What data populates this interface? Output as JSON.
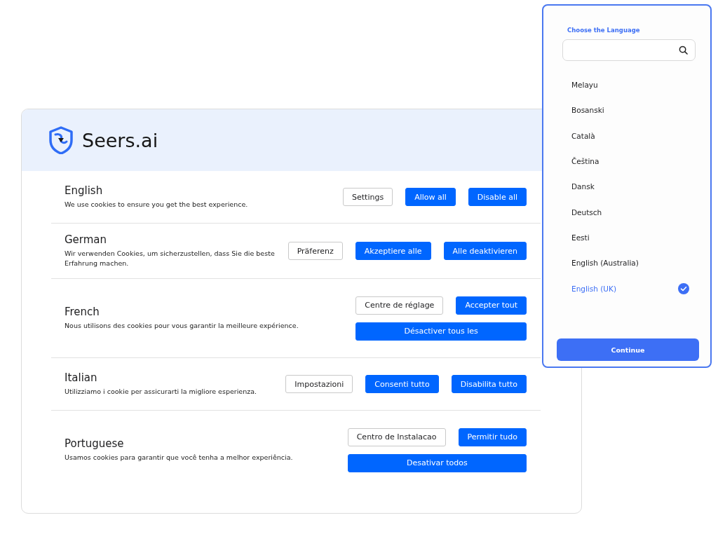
{
  "brand": {
    "name": "Seers.ai"
  },
  "languages": [
    {
      "title": "English",
      "text": "We use cookies to ensure you get the best experience.",
      "buttons": [
        {
          "label": "Settings",
          "kind": "outline"
        },
        {
          "label": "Allow all",
          "kind": "primary"
        },
        {
          "label": "Disable all",
          "kind": "primary"
        }
      ]
    },
    {
      "title": "German",
      "text": "Wir verwenden Cookies, um sicherzustellen, dass Sie die beste Erfahrung machen.",
      "buttons": [
        {
          "label": "Präferenz",
          "kind": "outline"
        },
        {
          "label": "Akzeptiere alle",
          "kind": "primary"
        },
        {
          "label": "Alle deaktivieren",
          "kind": "primary"
        }
      ]
    },
    {
      "title": "French",
      "text": "Nous utilisons des cookies pour vous garantir la meilleure expérience.",
      "buttons": [
        {
          "label": "Centre de réglage",
          "kind": "outline"
        },
        {
          "label": "Accepter tout",
          "kind": "primary"
        },
        {
          "label": "Désactiver tous les",
          "kind": "wide"
        }
      ]
    },
    {
      "title": "Italian",
      "text": "Utilizziamo i cookie per assicurarti la migliore esperienza.",
      "buttons": [
        {
          "label": "Impostazioni",
          "kind": "outline"
        },
        {
          "label": "Consenti tutto",
          "kind": "primary"
        },
        {
          "label": "Disabilita tutto",
          "kind": "primary"
        }
      ]
    },
    {
      "title": "Portuguese",
      "text": "Usamos cookies para garantir que você tenha a melhor experiência.",
      "buttons": [
        {
          "label": "Centro de Instalacao",
          "kind": "outline"
        },
        {
          "label": "Permitir tudo",
          "kind": "primary"
        },
        {
          "label": "Desativar todos",
          "kind": "wide"
        }
      ]
    }
  ],
  "picker": {
    "title": "Choose the Language",
    "options": [
      {
        "label": "Melayu",
        "selected": false
      },
      {
        "label": "Bosanski",
        "selected": false
      },
      {
        "label": "Català",
        "selected": false
      },
      {
        "label": "Čeština",
        "selected": false
      },
      {
        "label": "Dansk",
        "selected": false
      },
      {
        "label": "Deutsch",
        "selected": false
      },
      {
        "label": "Eesti",
        "selected": false
      },
      {
        "label": "English (Australia)",
        "selected": false
      },
      {
        "label": "English (UK)",
        "selected": true
      }
    ],
    "button": "Continue"
  }
}
